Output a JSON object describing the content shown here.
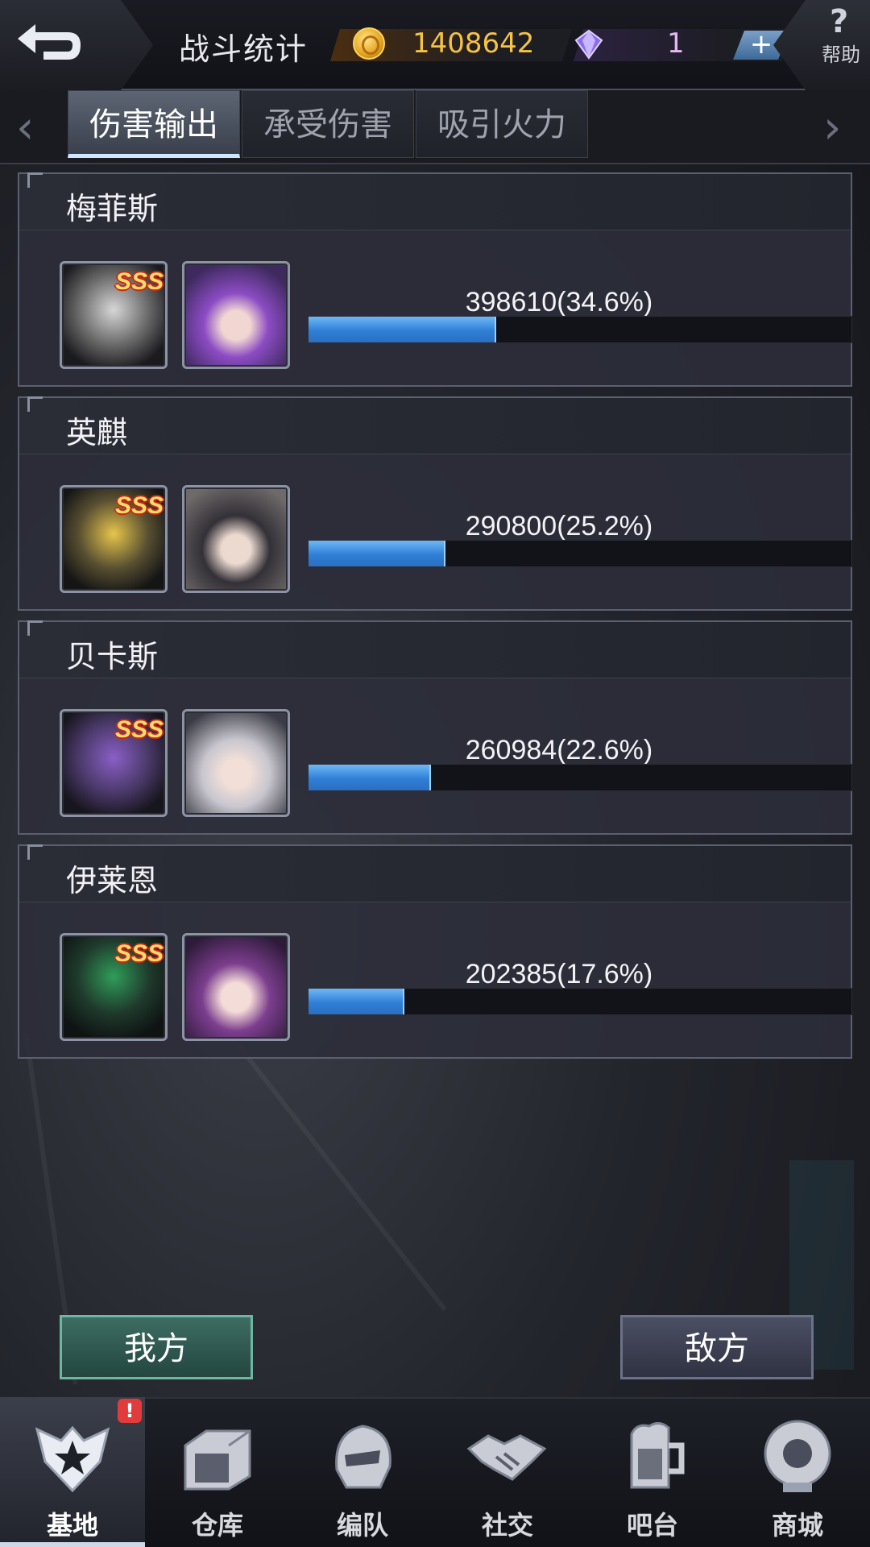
{
  "header": {
    "title": "战斗统计",
    "gold": "1408642",
    "gems": "1",
    "plus_label": "+",
    "help_symbol": "?",
    "help_label": "帮助"
  },
  "tabs": [
    {
      "label": "伤害输出",
      "active": true
    },
    {
      "label": "承受伤害",
      "active": false
    },
    {
      "label": "吸引火力",
      "active": false
    }
  ],
  "entries": [
    {
      "name": "梅菲斯",
      "rank": "SSS",
      "damage": "398610(34.6%)",
      "percent": 34.6
    },
    {
      "name": "英麒",
      "rank": "SSS",
      "damage": "290800(25.2%)",
      "percent": 25.2
    },
    {
      "name": "贝卡斯",
      "rank": "SSS",
      "damage": "260984(22.6%)",
      "percent": 22.6
    },
    {
      "name": "伊莱恩",
      "rank": "SSS",
      "damage": "202385(17.6%)",
      "percent": 17.6
    }
  ],
  "side_buttons": {
    "ours": "我方",
    "enemy": "敌方"
  },
  "nav": [
    {
      "label": "基地",
      "icon": "base-emblem-icon",
      "active": true,
      "badge": "!"
    },
    {
      "label": "仓库",
      "icon": "warehouse-icon",
      "active": false
    },
    {
      "label": "编队",
      "icon": "formation-helmet-icon",
      "active": false
    },
    {
      "label": "社交",
      "icon": "handshake-icon",
      "active": false
    },
    {
      "label": "吧台",
      "icon": "beer-mug-icon",
      "active": false
    },
    {
      "label": "商城",
      "icon": "shop-robot-icon",
      "active": false
    }
  ],
  "colors": {
    "bar": "#2f7fd6",
    "gold": "#f6c343",
    "gem": "#e7b6f5",
    "badge": "#e23b3b"
  }
}
